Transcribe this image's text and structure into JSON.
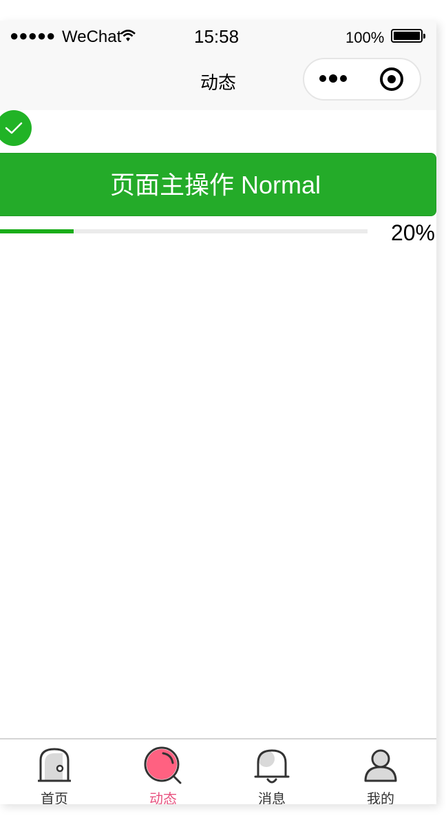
{
  "status_bar": {
    "signal": "●●●●●",
    "carrier": "WeChat",
    "time": "15:58",
    "battery": "100%"
  },
  "nav_bar": {
    "title": "动态"
  },
  "content": {
    "button_label": "页面主操作 Normal",
    "progress_fraction": 0.2,
    "progress_label": "20%"
  },
  "tab_bar": {
    "tabs": [
      {
        "label": "首页",
        "icon": "home-icon",
        "active": false
      },
      {
        "label": "动态",
        "icon": "search-icon",
        "active": true
      },
      {
        "label": "消息",
        "icon": "bell-icon",
        "active": false
      },
      {
        "label": "我的",
        "icon": "user-icon",
        "active": false
      }
    ]
  },
  "colors": {
    "primary_green": "#24ab29",
    "active_pink": "#ff6181"
  }
}
